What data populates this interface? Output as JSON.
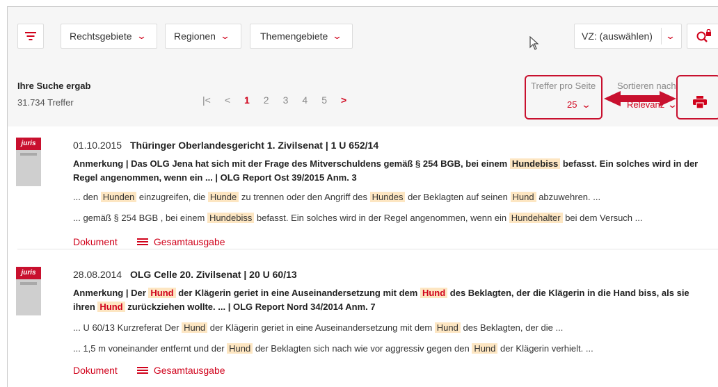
{
  "toolbar": {
    "filter_icon": "filter-icon",
    "dropdowns": [
      {
        "label": "Rechtsgebiete"
      },
      {
        "label": "Regionen"
      },
      {
        "label": "Themengebiete"
      }
    ],
    "vz_label": "VZ: (auswählen)",
    "search_icon": "search-lock-icon"
  },
  "result_header": {
    "title": "Ihre Suche ergab",
    "count": "31.734 Treffer",
    "pagination": {
      "first": "|<",
      "prev": "<",
      "pages": [
        "1",
        "2",
        "3",
        "4",
        "5"
      ],
      "current": "1",
      "next": ">"
    },
    "per_page_label": "Treffer pro Seite",
    "per_page_value": "25",
    "sort_label": "Sortieren nach",
    "sort_value": "Relevanz",
    "print_icon": "printer-icon"
  },
  "results": [
    {
      "logo": "juris",
      "date": "01.10.2015",
      "court": "Thüringer Oberlandesgericht 1. Zivilsenat | 1 U 652/14",
      "abstract": [
        {
          "t": "Anmerkung | Das OLG Jena hat sich mit der Frage des Mitverschuldens gemäß § 254 BGB, bei einem "
        },
        {
          "t": "Hundebiss",
          "hit": true
        },
        {
          "t": " befasst. Ein solches wird in der Regel angenommen, wenn ein ... | OLG Report Ost 39/2015 Anm. 3"
        }
      ],
      "snippets": [
        [
          {
            "t": "... den "
          },
          {
            "t": "Hunden",
            "hit": true
          },
          {
            "t": " einzugreifen, die "
          },
          {
            "t": "Hunde",
            "hit": true
          },
          {
            "t": " zu trennen oder den Angriff des "
          },
          {
            "t": "Hundes",
            "hit": true
          },
          {
            "t": " der Beklagten auf seinen "
          },
          {
            "t": "Hund",
            "hit": true
          },
          {
            "t": " abzuwehren. ..."
          }
        ],
        [
          {
            "t": "... gemäß § 254 BGB , bei einem "
          },
          {
            "t": "Hundebiss",
            "hit": true
          },
          {
            "t": " befasst. Ein solches wird in der Regel angenommen, wenn ein "
          },
          {
            "t": "Hundehalter",
            "hit": true
          },
          {
            "t": " bei dem Versuch ..."
          }
        ]
      ],
      "link_document": "Dokument",
      "link_full": "Gesamtausgabe"
    },
    {
      "logo": "juris",
      "date": "28.08.2014",
      "court": "OLG Celle 20. Zivilsenat | 20 U 60/13",
      "abstract": [
        {
          "t": "Anmerkung | Der "
        },
        {
          "t": "Hund",
          "hit": true,
          "red": true
        },
        {
          "t": " der Klägerin geriet in eine Auseinandersetzung mit dem "
        },
        {
          "t": "Hund",
          "hit": true,
          "red": true
        },
        {
          "t": " des Beklagten, der die Klägerin in die Hand biss, als sie ihren "
        },
        {
          "t": "Hund",
          "hit": true,
          "red": true
        },
        {
          "t": " zurückziehen wollte. ... | OLG Report Nord 34/2014 Anm. 7"
        }
      ],
      "snippets": [
        [
          {
            "t": "... U 60/13 Kurzreferat Der "
          },
          {
            "t": "Hund",
            "hit": true
          },
          {
            "t": " der Klägerin geriet in eine Auseinandersetzung mit dem "
          },
          {
            "t": "Hund",
            "hit": true
          },
          {
            "t": " des Beklagten, der die ..."
          }
        ],
        [
          {
            "t": "... 1,5 m voneinander entfernt und der "
          },
          {
            "t": "Hund",
            "hit": true
          },
          {
            "t": " der Beklagten sich nach wie vor aggressiv gegen den "
          },
          {
            "t": "Hund",
            "hit": true
          },
          {
            "t": " der Klägerin verhielt. ..."
          }
        ]
      ],
      "link_document": "Dokument",
      "link_full": "Gesamtausgabe"
    }
  ],
  "colors": {
    "accent": "#d0021b",
    "highlight": "#fde6c2",
    "callout": "#c8102e"
  }
}
